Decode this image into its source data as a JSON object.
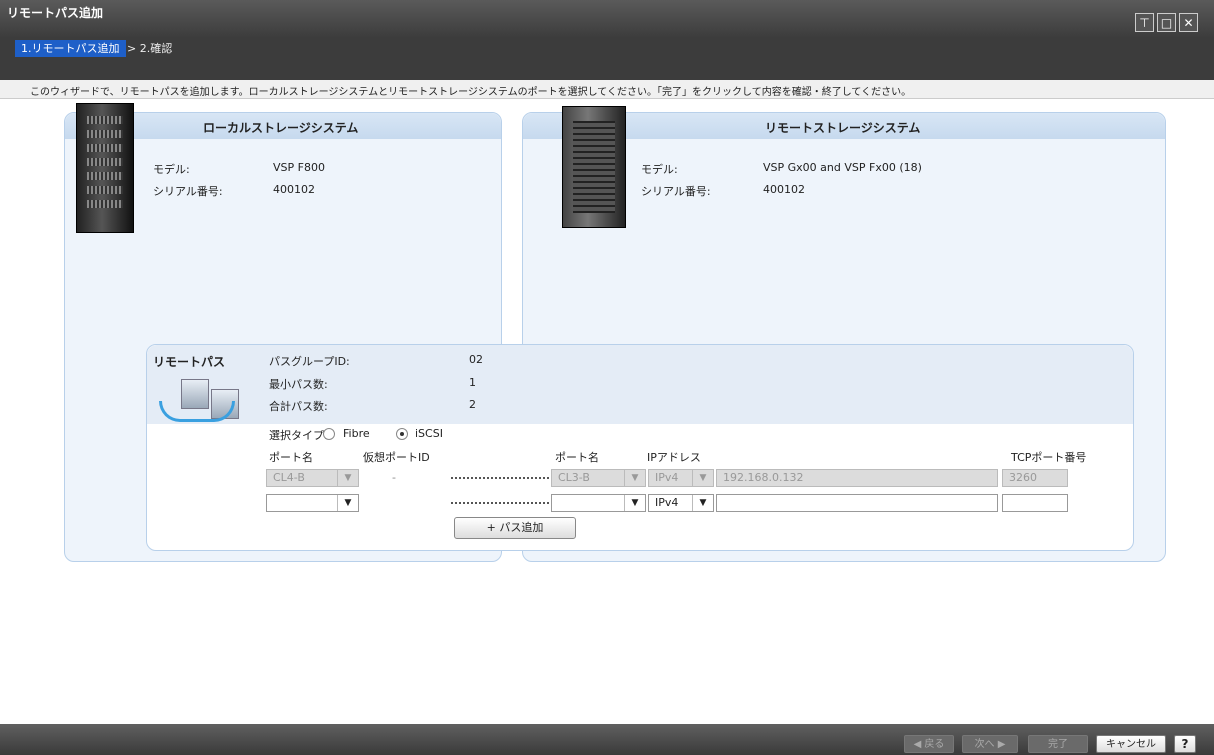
{
  "window": {
    "title": "リモートパス追加"
  },
  "wizard": {
    "step1": "1.リモートパス追加",
    "separator": ">",
    "step2": "2.確認",
    "description": "このウィザードで、リモートパスを追加します。ローカルストレージシステムとリモートストレージシステムのポートを選択してください。「完了」をクリックして内容を確認・終了してください。"
  },
  "local": {
    "title": "ローカルストレージシステム",
    "model_label": "モデル:",
    "model_value": "VSP F800",
    "serial_label": "シリアル番号:",
    "serial_value": "400102"
  },
  "remote": {
    "title": "リモートストレージシステム",
    "model_label": "モデル:",
    "model_value": "VSP Gx00 and VSP Fx00 (18)",
    "serial_label": "シリアル番号:",
    "serial_value": "400102"
  },
  "remote_path": {
    "title": "リモートパス",
    "path_group_label": "パスグループID:",
    "path_group_value": "02",
    "min_paths_label": "最小パス数:",
    "min_paths_value": "1",
    "total_paths_label": "合計パス数:",
    "total_paths_value": "2",
    "select_type_label": "選択タイプ:",
    "type_fibre": "Fibre",
    "type_iscsi": "iSCSI",
    "selected_type": "iSCSI",
    "col_port": "ポート名",
    "col_virtual_port": "仮想ポートID",
    "col_remote_port": "ポート名",
    "col_ip": "IPアドレス",
    "col_tcp": "TCPポート番号",
    "rows": [
      {
        "local_port": "CL4-B",
        "virtual_port": "-",
        "remote_port": "CL3-B",
        "ip_version": "IPv4",
        "ip_address": "192.168.0.132",
        "tcp_port": "3260"
      },
      {
        "local_port": "",
        "virtual_port": "",
        "remote_port": "",
        "ip_version": "IPv4",
        "ip_address": "",
        "tcp_port": ""
      }
    ],
    "add_path_button": "+ パス追加"
  },
  "footer": {
    "back": "◀ 戻る",
    "next": "次へ ▶",
    "finish": "完了",
    "cancel": "キャンセル",
    "help": "?"
  },
  "colors": {
    "step_active": "#1e5fc8",
    "panel_header": "#c6d9ee",
    "panel_bg": "#eef4fb"
  },
  "icons": [
    "pin-icon",
    "restore-icon",
    "close-icon",
    "server-icon",
    "remote-path-icon",
    "help-icon"
  ]
}
